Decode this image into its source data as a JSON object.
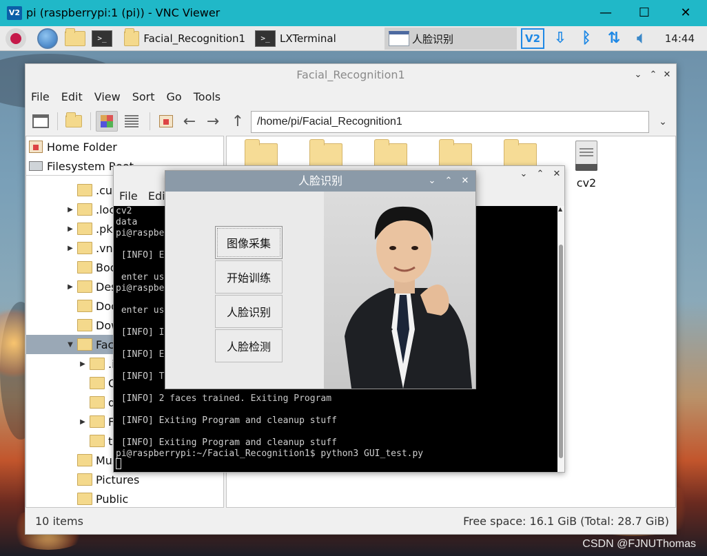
{
  "vnc": {
    "logo": "V2",
    "title": "pi (raspberrypi:1 (pi)) - VNC Viewer",
    "minimize": "—",
    "maximize": "☐",
    "close": "✕"
  },
  "panel": {
    "tasks": [
      {
        "label": "Facial_Recognition1"
      },
      {
        "label": "LXTerminal"
      },
      {
        "label": "人脸识别"
      }
    ],
    "tray_vnc": "V2",
    "clock": "14:44"
  },
  "file_manager": {
    "title": "Facial_Recognition1",
    "menu": [
      "File",
      "Edit",
      "View",
      "Sort",
      "Go",
      "Tools"
    ],
    "path": "/home/pi/Facial_Recognition1",
    "places": [
      "Home Folder",
      "Filesystem Root"
    ],
    "tree": [
      {
        "label": ".cup"
      },
      {
        "label": ".loc"
      },
      {
        "label": ".pki"
      },
      {
        "label": ".vnc"
      },
      {
        "label": "Boo"
      },
      {
        "label": "Des"
      },
      {
        "label": "Doc"
      },
      {
        "label": "Dow"
      },
      {
        "label": "Fac"
      },
      {
        "label": ".i"
      },
      {
        "label": "C"
      },
      {
        "label": "d"
      },
      {
        "label": "F"
      },
      {
        "label": "tr"
      },
      {
        "label": "Mus"
      },
      {
        "label": "Pictures"
      },
      {
        "label": "Public"
      }
    ],
    "file_label": "cv2",
    "status_left": "10 items",
    "status_right": "Free space: 16.1 GiB (Total: 28.7 GiB)"
  },
  "terminal": {
    "menu": [
      "File",
      "Edit"
    ],
    "lines": [
      "cv2",
      "data",
      "pi@raspbe",
      "",
      " [INFO] E",
      "",
      " enter us",
      "pi@raspbe",
      " enter us",
      "",
      " [INFO] I",
      "",
      " [INFO] E",
      "",
      " [INFO] T",
      "",
      " [INFO] 2 faces trained. Exiting Program",
      "",
      " [INFO] Exiting Program and cleanup stuff",
      "",
      " [INFO] Exiting Program and cleanup stuff",
      "pi@raspberrypi:~/Facial_Recognition1$ python3 GUI_test.py"
    ]
  },
  "face_app": {
    "title": "人脸识别",
    "buttons": [
      "图像采集",
      "开始训练",
      "人脸识别",
      "人脸检测"
    ]
  },
  "watermark": "CSDN @FJNUThomas"
}
